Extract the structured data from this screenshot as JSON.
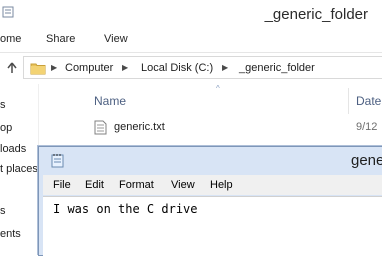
{
  "explorer": {
    "title": "_generic_folder",
    "ribbon_tabs": [
      "ome",
      "Share",
      "View"
    ],
    "breadcrumbs": [
      "Computer",
      "Local Disk (C:)",
      "_generic_folder"
    ],
    "breadcrumb_separator": "▶",
    "nav_items": [
      "s",
      "op",
      "loads",
      "t places",
      "s",
      "ents"
    ],
    "columns": {
      "name": "Name",
      "date": "Date"
    },
    "files": [
      {
        "name": "generic.txt",
        "date": "9/12"
      }
    ],
    "icons": {
      "folder": "folder-icon",
      "file": "text-file-icon",
      "up": "up-arrow-icon"
    }
  },
  "notepad": {
    "title_fragment": "gene",
    "menu": [
      "File",
      "Edit",
      "Format",
      "View",
      "Help"
    ],
    "content": "I was on the C drive"
  }
}
